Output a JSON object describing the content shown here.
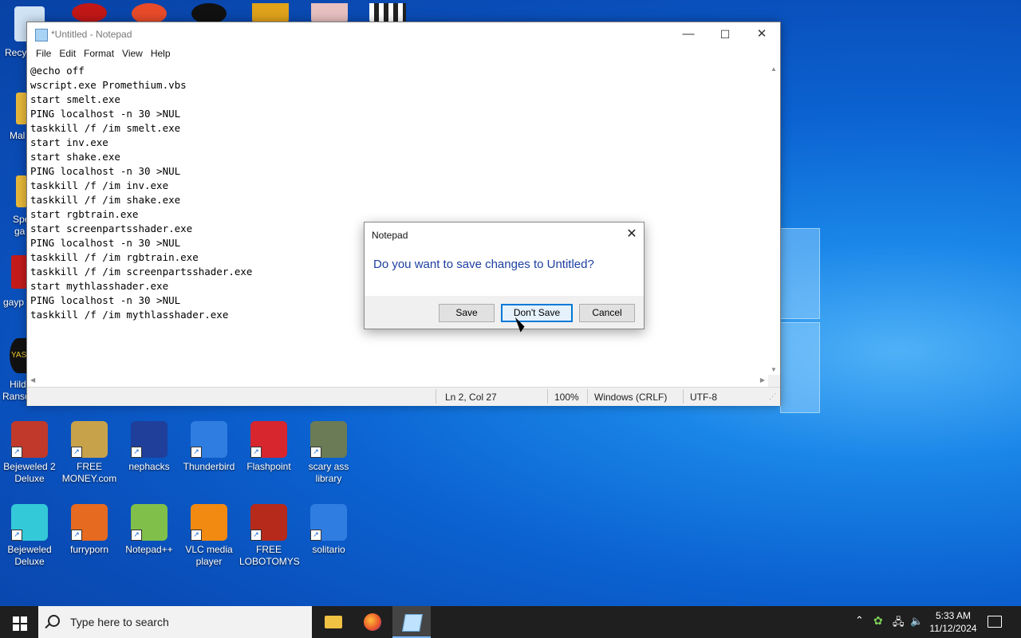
{
  "notepad": {
    "title": "*Untitled - Notepad",
    "controls": {
      "minimize": "—",
      "maximize": "☐",
      "close": "✕"
    },
    "menu": [
      "File",
      "Edit",
      "Format",
      "View",
      "Help"
    ],
    "content": "@echo off\nwscript.exe Promethium.vbs\nstart smelt.exe\nPING localhost -n 30 >NUL\ntaskkill /f /im smelt.exe\nstart inv.exe\nstart shake.exe\nPING localhost -n 30 >NUL\ntaskkill /f /im inv.exe\ntaskkill /f /im shake.exe\nstart rgbtrain.exe\nstart screenpartsshader.exe\nPING localhost -n 30 >NUL\ntaskkill /f /im rgbtrain.exe\ntaskkill /f /im screenpartsshader.exe\nstart mythlasshader.exe\nPING localhost -n 30 >NUL\ntaskkill /f /im mythlasshader.exe",
    "status": {
      "position": "Ln 2, Col 27",
      "zoom": "100%",
      "line_ending": "Windows (CRLF)",
      "encoding": "UTF-8"
    }
  },
  "dialog": {
    "title": "Notepad",
    "message": "Do you want to save changes to Untitled?",
    "buttons": {
      "save": "Save",
      "dont_save": "Don't Save",
      "cancel": "Cancel"
    }
  },
  "desktop": {
    "partial_labels": [
      "Recy",
      "Mal",
      "Spe",
      "ga",
      "gayp",
      "Hild",
      "Ranso",
      "YAS"
    ],
    "icons_row1": [
      {
        "label": "Bejeweled 2 Deluxe",
        "icon": "bejeweled2-icon",
        "color": "#c0392b"
      },
      {
        "label": "FREE MONEY.com",
        "icon": "money-bag-icon",
        "color": "#c8a24a"
      },
      {
        "label": "nephacks",
        "icon": "mpi-icon",
        "color": "#1f3f9a"
      },
      {
        "label": "Thunderbird",
        "icon": "thunderbird-icon",
        "color": "#2f7de1"
      },
      {
        "label": "Flashpoint",
        "icon": "flashpoint-icon",
        "color": "#d8262e"
      },
      {
        "label": "scary ass library",
        "icon": "library-icon",
        "color": "#6b7b55"
      }
    ],
    "icons_row2": [
      {
        "label": "Bejeweled Deluxe",
        "icon": "bejeweled-icon",
        "color": "#33c9d8"
      },
      {
        "label": "furryporn",
        "icon": "firefox-icon",
        "color": "#e66a1f"
      },
      {
        "label": "Notepad++",
        "icon": "notepadpp-icon",
        "color": "#7fbf4a"
      },
      {
        "label": "VLC media player",
        "icon": "vlc-icon",
        "color": "#f28a12"
      },
      {
        "label": "FREE LOBOTOMYS",
        "icon": "lobotomy-icon",
        "color": "#b52a1a"
      },
      {
        "label": "solitario",
        "icon": "solitaire-icon",
        "color": "#2f7de1"
      }
    ]
  },
  "taskbar": {
    "search_placeholder": "Type here to search",
    "time": "5:33 AM",
    "date": "11/12/2024"
  }
}
